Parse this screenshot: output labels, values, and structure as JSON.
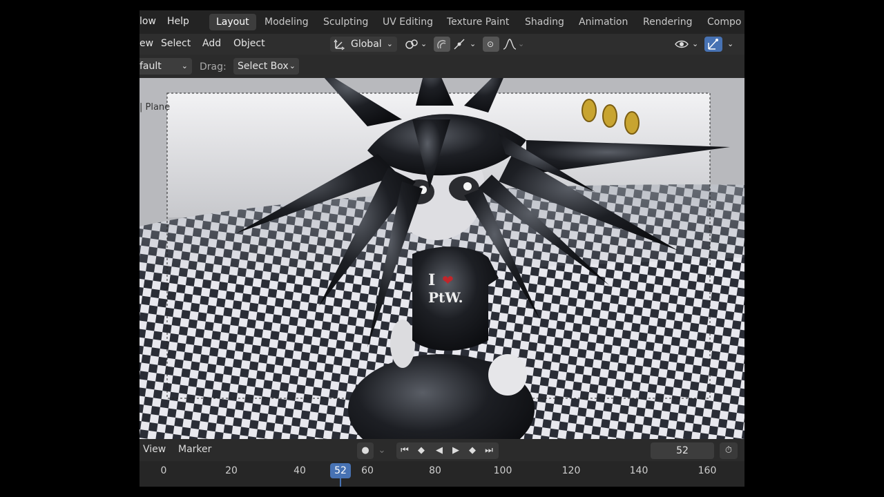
{
  "top_menu": {
    "items": [
      "low",
      "Help"
    ]
  },
  "workspaces": {
    "tabs": [
      "Layout",
      "Modeling",
      "Sculpting",
      "UV Editing",
      "Texture Paint",
      "Shading",
      "Animation",
      "Rendering",
      "Compo"
    ],
    "active": "Layout"
  },
  "header": {
    "menus": [
      "ew",
      "Select",
      "Add",
      "Object"
    ],
    "transform_orientation": "Global"
  },
  "tool_settings": {
    "mode_value": "fault",
    "drag_label": "Drag:",
    "drag_value": "Select Box"
  },
  "viewport": {
    "object_label": "| Plane"
  },
  "timeline": {
    "menus": [
      "View",
      "Marker"
    ],
    "current_frame": "52",
    "ruler": [
      "0",
      "20",
      "40",
      "52",
      "60",
      "80",
      "100",
      "120",
      "140",
      "160"
    ]
  },
  "icons": {
    "transform_pivot": "pivot-icon",
    "snap": "snap-icon",
    "proportional": "proportional-icon",
    "falloff": "falloff-curve-icon",
    "overlay": "eye-icon",
    "gizmo": "gizmo-icon",
    "timer": "stopwatch-icon"
  },
  "colors": {
    "accent": "#4772b3",
    "active_tab": "#3d3d3d",
    "frame_badge": "#4772b3"
  }
}
